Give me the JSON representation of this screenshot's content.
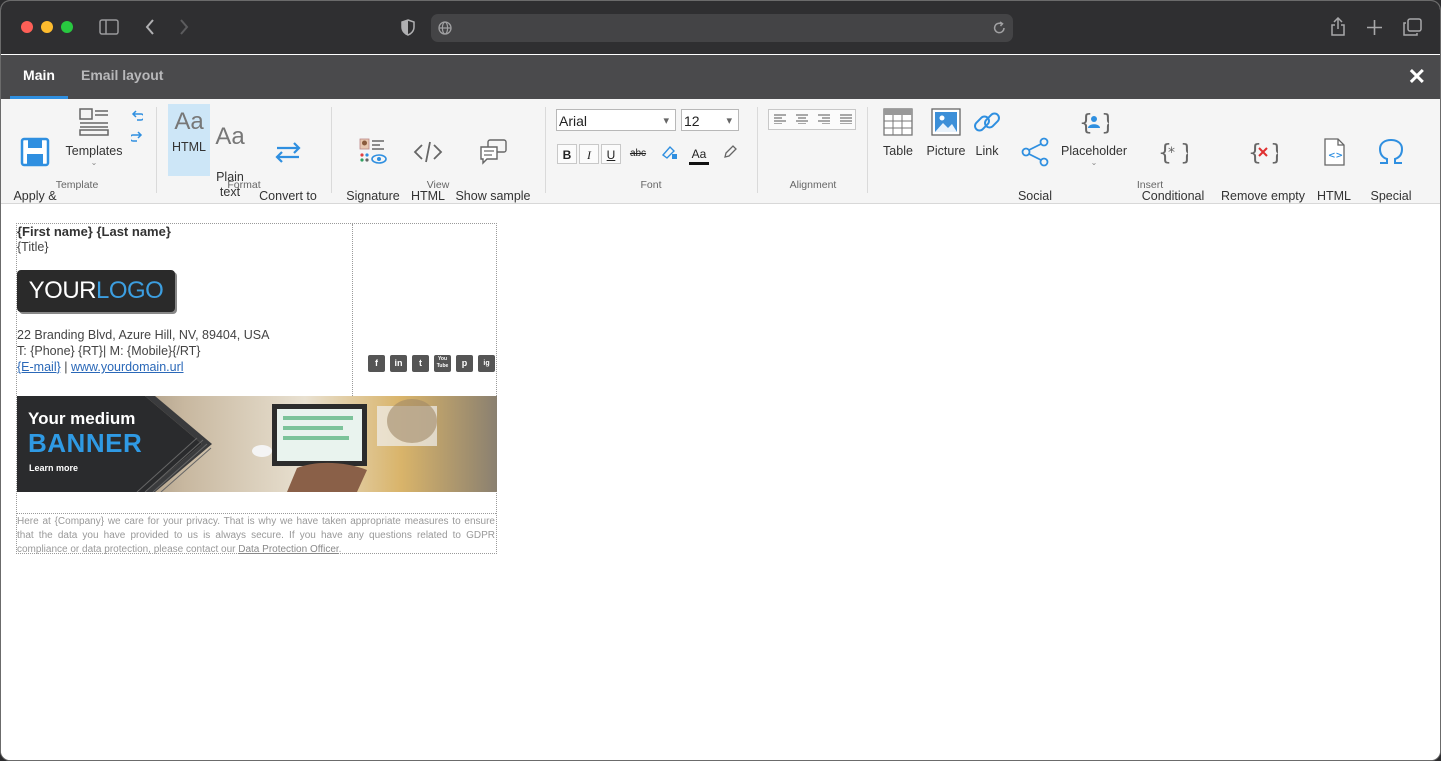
{
  "tabs": {
    "main": "Main",
    "email_layout": "Email layout"
  },
  "ribbon": {
    "template": {
      "apply_close": "Apply &\nClose",
      "templates": "Templates",
      "label": "Template"
    },
    "format": {
      "html": "HTML",
      "plain_text": "Plain\ntext",
      "convert": "Convert to\nplain text",
      "label": "Format",
      "aa": "Aa"
    },
    "view": {
      "signature_preview": "Signature\npreview",
      "html_source": "HTML\nsource",
      "sample_thread": "Show sample\nemail thread",
      "label": "View"
    },
    "font": {
      "family": "Arial",
      "size": "12",
      "bold": "B",
      "italic": "I",
      "underline": "U",
      "strike": "abc",
      "aa": "Aa",
      "label": "Font"
    },
    "alignment": {
      "label": "Alignment"
    },
    "insert": {
      "table": "Table",
      "picture": "Picture",
      "link": "Link",
      "social_link": "Social\nlink",
      "placeholder": "Placeholder",
      "conditional": "Conditional\nplaceholder",
      "remove_empty": "Remove empty\nplaceholder",
      "html_snippet": "HTML\nsnippet",
      "special_char": "Special\ncharacter",
      "label": "Insert"
    }
  },
  "signature": {
    "name": "{First name} {Last name}",
    "title": "{Title}",
    "logo": {
      "part1": "YOUR",
      "part2": "LOGO"
    },
    "address": "22 Branding Blvd, Azure Hill, NV, 89404, USA",
    "phone_line": "T: {Phone} {RT}| M: {Mobile}{/RT}",
    "email": "{E-mail}",
    "separator": " | ",
    "website": "www.yourdomain.url",
    "social": [
      "f",
      "in",
      "t",
      "You\nTube",
      "p",
      "ig"
    ],
    "banner": {
      "line1": "Your medium",
      "line2": "BANNER",
      "cta": "Learn more"
    },
    "privacy": "Here at {Company} we care for your privacy. That is why we have taken appropriate measures to ensure that the data you have provided to us is always secure. If you have any questions related to GDPR compliance or data protection, please contact our ",
    "privacy_link": "Data Protection Officer",
    "privacy_end": "."
  },
  "colors": {
    "accent": "#2f8fe0",
    "tabbar": "#4a4a4c",
    "ribbon_bg": "#f5f5f5",
    "banner_blue": "#2f9ae4"
  }
}
